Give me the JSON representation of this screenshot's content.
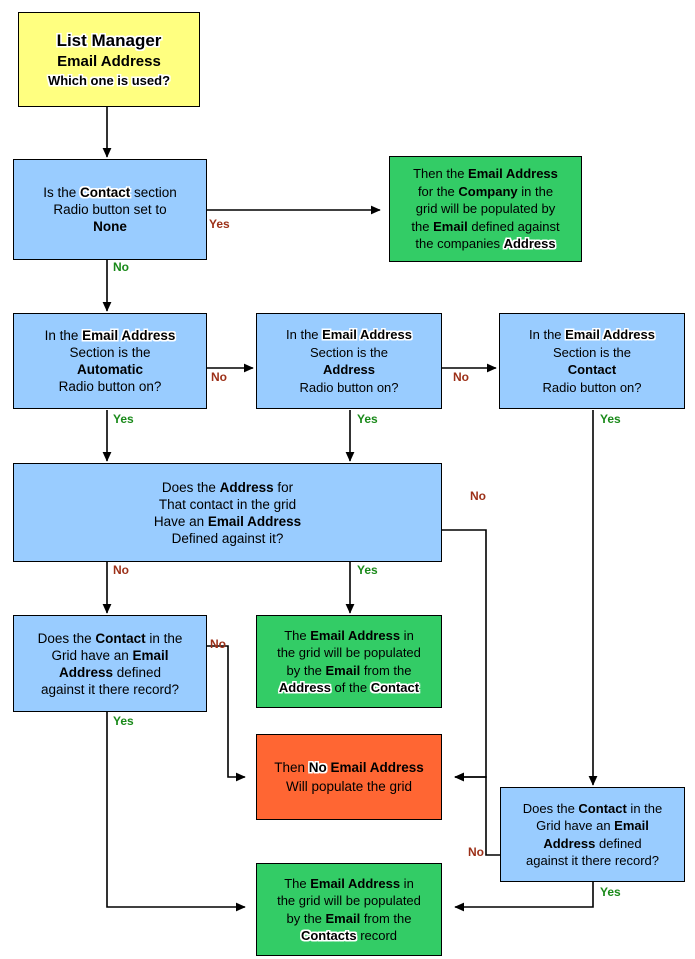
{
  "diagram": {
    "title": "List Manager Email Address decision flowchart",
    "colors": {
      "start": "#ffff80",
      "decision": "#99ccff",
      "outcome_positive": "#33cc66",
      "outcome_negative": "#ff6633",
      "label_yes": "#1a8a1a",
      "label_no": "#9c3018",
      "stroke": "#000000",
      "background": "#ffffff"
    },
    "nodes": {
      "start": {
        "id": "start",
        "shape": "box",
        "fill": "#ffff80",
        "line1": "List Manager",
        "line2": "Email Address",
        "line3": "Which one is used?"
      },
      "q_contact_none": {
        "id": "q_contact_none",
        "shape": "box",
        "fill": "#99ccff",
        "line1_a": "Is the ",
        "line1_b": "Contact",
        "line1_c": " section",
        "line2": "Radio button set to",
        "line3": "None"
      },
      "out_company_address": {
        "id": "out_company_address",
        "shape": "box",
        "fill": "#33cc66",
        "l1_a": "Then the ",
        "l1_b": "Email Address",
        "l2_a": "for the ",
        "l2_b": "Company",
        "l2_c": " in the",
        "l3": "grid will be populated by",
        "l4_a": "the ",
        "l4_b": "Email",
        "l4_c": " defined against",
        "l5_a": "the companies ",
        "l5_b": "Address"
      },
      "q_automatic": {
        "id": "q_automatic",
        "shape": "box",
        "fill": "#99ccff",
        "l1_a": "In the ",
        "l1_b": "Email Address",
        "l2": "Section is the",
        "l3": "Automatic",
        "l4": "Radio button on?"
      },
      "q_address": {
        "id": "q_address",
        "shape": "box",
        "fill": "#99ccff",
        "l1_a": "In the ",
        "l1_b": "Email Address",
        "l2": "Section is the",
        "l3": "Address",
        "l4": "Radio button on?"
      },
      "q_contact": {
        "id": "q_contact",
        "shape": "box",
        "fill": "#99ccff",
        "l1_a": "In the ",
        "l1_b": "Email Address",
        "l2": "Section is the",
        "l3": "Contact",
        "l4": "Radio button on?"
      },
      "q_address_has_email": {
        "id": "q_address_has_email",
        "shape": "box",
        "fill": "#99ccff",
        "l1_a": "Does the ",
        "l1_b": "Address",
        "l1_c": " for",
        "l2": "That contact in the grid",
        "l3_a": "Have an ",
        "l3_b": "Email Address",
        "l4": "Defined against it?"
      },
      "q_contact_has_email_left": {
        "id": "q_contact_has_email_left",
        "shape": "box",
        "fill": "#99ccff",
        "l1_a": "Does the ",
        "l1_b": "Contact",
        "l1_c": " in the",
        "l2_a": "Grid have an ",
        "l2_b": "Email",
        "l3_a": "Address",
        "l3_b": " defined",
        "l4": "against it there record?"
      },
      "out_address_of_contact": {
        "id": "out_address_of_contact",
        "shape": "box",
        "fill": "#33cc66",
        "l1_a": "The ",
        "l1_b": "Email Address",
        "l1_c": " in",
        "l2": "the grid will be populated",
        "l3_a": "by the ",
        "l3_b": "Email",
        "l3_c": " from the",
        "l4_a": "Address",
        "l4_b": " of the ",
        "l4_c": "Contact"
      },
      "out_no_email": {
        "id": "out_no_email",
        "shape": "box",
        "fill": "#ff6633",
        "l1_a": "Then ",
        "l1_b": "No",
        "l1_c": " Email Address",
        "l2": "Will populate the grid"
      },
      "q_contact_has_email_right": {
        "id": "q_contact_has_email_right",
        "shape": "box",
        "fill": "#99ccff",
        "l1_a": "Does the ",
        "l1_b": "Contact",
        "l1_c": " in the",
        "l2_a": "Grid have an ",
        "l2_b": "Email",
        "l3_a": "Address",
        "l3_b": " defined",
        "l4": "against it there record?"
      },
      "out_contacts_record": {
        "id": "out_contacts_record",
        "shape": "box",
        "fill": "#33cc66",
        "l1_a": "The ",
        "l1_b": "Email Address",
        "l1_c": " in",
        "l2": "the grid will be populated",
        "l3_a": "by the ",
        "l3_b": "Email",
        "l3_c": " from the",
        "l4_a": "Contacts",
        "l4_b": " record"
      }
    },
    "edge_labels": {
      "e1_yes": "Yes",
      "e1_no": "No",
      "e2_no": "No",
      "e3_no": "No",
      "e4_yes": "Yes",
      "e5_yes": "Yes",
      "e6_yes": "Yes",
      "e7_no": "No",
      "e8_no": "No",
      "e9_yes": "Yes",
      "e10_no": "No",
      "e11_yes": "Yes",
      "e12_no": "No",
      "e13_yes": "Yes"
    },
    "edges": [
      {
        "from": "start",
        "to": "q_contact_none",
        "label": ""
      },
      {
        "from": "q_contact_none",
        "to": "out_company_address",
        "label": "Yes"
      },
      {
        "from": "q_contact_none",
        "to": "q_automatic",
        "label": "No"
      },
      {
        "from": "q_automatic",
        "to": "q_address",
        "label": "No"
      },
      {
        "from": "q_address",
        "to": "q_contact",
        "label": "No"
      },
      {
        "from": "q_automatic",
        "to": "q_address_has_email",
        "label": "Yes"
      },
      {
        "from": "q_address",
        "to": "q_address_has_email",
        "label": "Yes"
      },
      {
        "from": "q_contact",
        "to": "q_contact_has_email_right",
        "label": "Yes"
      },
      {
        "from": "q_address_has_email",
        "to": "q_contact_has_email_left",
        "label": "No"
      },
      {
        "from": "q_address_has_email",
        "to": "out_address_of_contact",
        "label": "Yes"
      },
      {
        "from": "q_address_has_email",
        "to": "out_no_email",
        "label": "No"
      },
      {
        "from": "q_contact_has_email_left",
        "to": "out_no_email",
        "label": "No"
      },
      {
        "from": "q_contact_has_email_left",
        "to": "out_contacts_record",
        "label": "Yes"
      },
      {
        "from": "q_contact_has_email_right",
        "to": "out_no_email",
        "label": "No"
      },
      {
        "from": "q_contact_has_email_right",
        "to": "out_contacts_record",
        "label": "Yes"
      }
    ]
  }
}
